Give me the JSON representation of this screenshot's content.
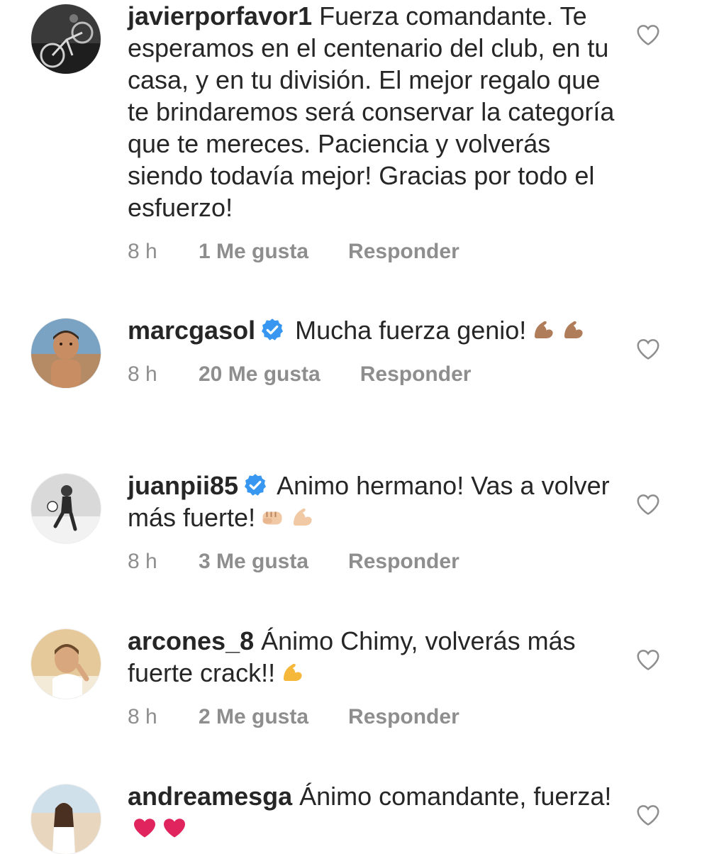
{
  "comments": [
    {
      "username": "javierporfavor1",
      "verified": false,
      "text": "Fuerza comandante. Te esperamos en el centenario del club, en tu casa, y en tu división. El mejor regalo que te brindaremos será conservar la categoría que te mereces. Paciencia y volverás siendo todavía mejor! Gracias por todo el esfuerzo!",
      "emojis": [],
      "time": "8 h",
      "likes": "1 Me gusta",
      "reply_label": "Responder",
      "avatar_icon": "bicycle-photo-avatar"
    },
    {
      "username": "marcgasol",
      "verified": true,
      "text": "Mucha fuerza genio!",
      "emojis": [
        "flexed-biceps-medium-skin",
        "flexed-biceps-medium-skin"
      ],
      "time": "8 h",
      "likes": "20 Me gusta",
      "reply_label": "Responder",
      "avatar_icon": "child-photo-avatar"
    },
    {
      "username": "juanpii85",
      "verified": true,
      "text": "Animo hermano! Vas a volver más fuerte!",
      "emojis": [
        "oncoming-fist-light-skin",
        "flexed-biceps-light-skin"
      ],
      "time": "8 h",
      "likes": "3 Me gusta",
      "reply_label": "Responder",
      "avatar_icon": "footballer-photo-avatar"
    },
    {
      "username": "arcones_8",
      "verified": false,
      "text": "Ánimo Chimy, volverás más fuerte crack!!",
      "emojis": [
        "flexed-biceps-default"
      ],
      "time": "8 h",
      "likes": "2 Me gusta",
      "reply_label": "Responder",
      "avatar_icon": "portrait-photo-avatar"
    },
    {
      "username": "andreamesga",
      "verified": false,
      "text": "Ánimo comandante, fuerza!",
      "emojis": [
        "red-heart",
        "red-heart"
      ],
      "time": "",
      "likes": "",
      "reply_label": "",
      "avatar_icon": "beach-photo-avatar"
    }
  ],
  "colors": {
    "text": "#262626",
    "meta": "#8e8e8e",
    "verified": "#3897f0",
    "heart_outline": "#8e8e8e"
  }
}
